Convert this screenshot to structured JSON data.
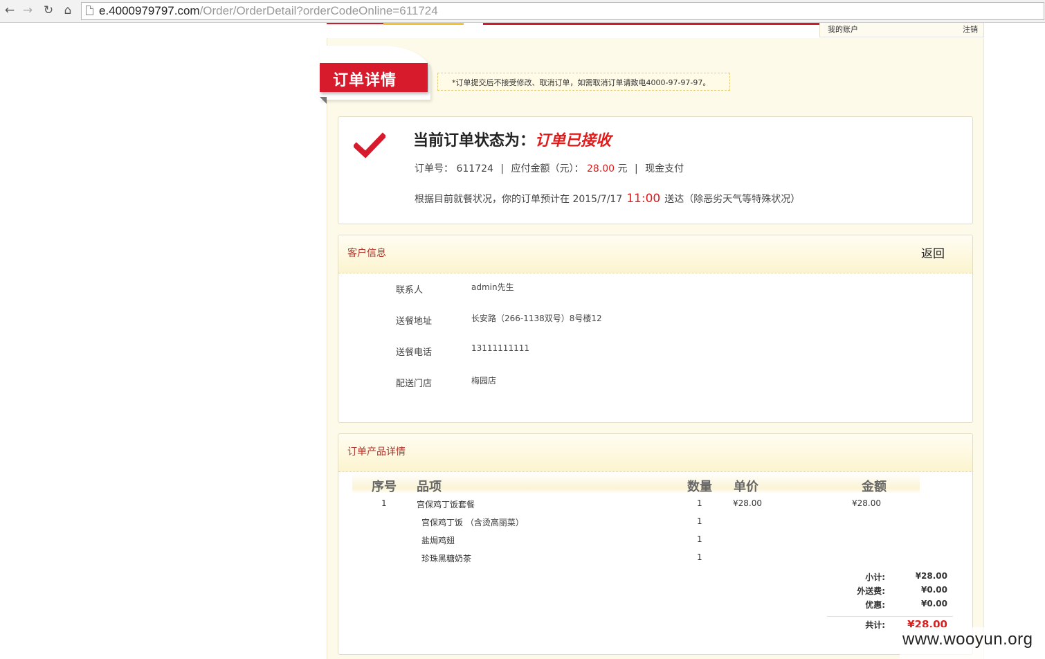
{
  "browser": {
    "url_host": "e.4000979797.com",
    "url_path": "/Order/OrderDetail?orderCodeOnline=611724"
  },
  "header": {
    "my_account": "我的账户",
    "logout": "注销"
  },
  "title": {
    "text": "订单详情",
    "notice": "*订单提交后不接受修改、取消订单，如需取消订单请致电4000-97-97-97。"
  },
  "status": {
    "prefix": "当前订单状态为：",
    "value": "订单已接收",
    "order_no_label": "订单号：",
    "order_no": "611724",
    "amount_label": "应付金额（元）：",
    "amount": "28.00",
    "amount_unit": "元",
    "payment": "现金支付",
    "eta_prefix": "根据目前就餐状况，你的订单预计在 2015/7/17",
    "eta_time": "11:00",
    "eta_suffix": "送达（除恶劣天气等特殊状况）"
  },
  "customer": {
    "title": "客户信息",
    "back": "返回",
    "fields": [
      {
        "label": "联系人",
        "value": "admin先生"
      },
      {
        "label": "送餐地址",
        "value": "长安路（266-1138双号）8号楼12"
      },
      {
        "label": "送餐电话",
        "value": "13111111111"
      },
      {
        "label": "配送门店",
        "value": "梅园店"
      }
    ]
  },
  "products": {
    "title": "订单产品详情",
    "headers": {
      "no": "序号",
      "item": "品项",
      "qty": "数量",
      "price": "单价",
      "amount": "金额"
    },
    "rows": [
      {
        "no": "1",
        "item": "宫保鸡丁饭套餐",
        "qty": "1",
        "price": "¥28.00",
        "amount": "¥28.00"
      },
      {
        "no": "",
        "item": "宫保鸡丁饭 （含烫高丽菜）",
        "qty": "1",
        "price": "",
        "amount": ""
      },
      {
        "no": "",
        "item": "盐焗鸡翅",
        "qty": "1",
        "price": "",
        "amount": ""
      },
      {
        "no": "",
        "item": "珍珠黑糖奶茶",
        "qty": "1",
        "price": "",
        "amount": ""
      }
    ],
    "summary": {
      "subtotal_label": "小计:",
      "subtotal": "¥28.00",
      "delivery_label": "外送费:",
      "delivery": "¥0.00",
      "discount_label": "优惠:",
      "discount": "¥0.00",
      "total_label": "共计:",
      "total": "¥28.00"
    }
  },
  "watermark": "www.wooyun.org",
  "colors": {
    "accent_red": "#d81b2c",
    "panel_bg": "#fefaea",
    "section_title": "#b0352a"
  }
}
